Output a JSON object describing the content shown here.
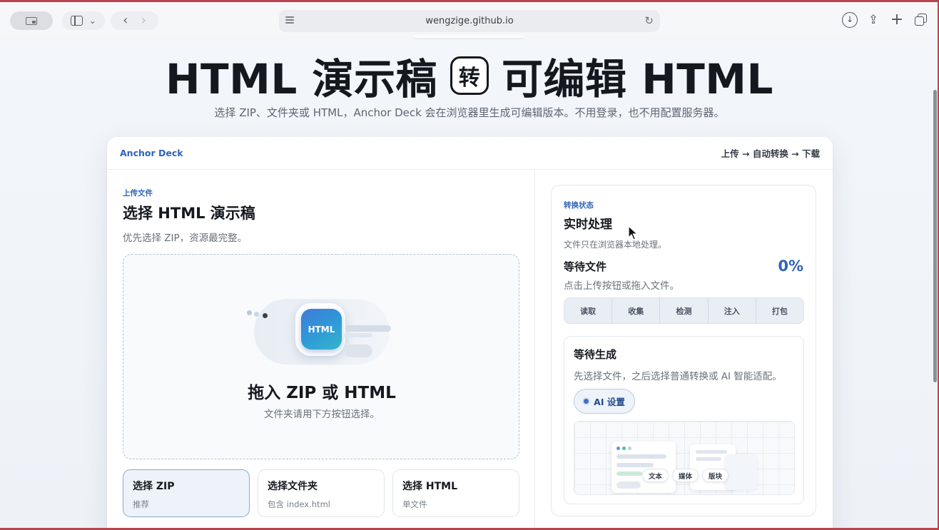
{
  "browser": {
    "url": "wengzige.github.io",
    "back_glyph": "‹",
    "forward_glyph": "›",
    "chevron_glyph": "⌄",
    "reload_glyph": "↻",
    "download_glyph": "↓",
    "share_glyph": "⇪",
    "plus_glyph": "+"
  },
  "hero": {
    "title_left": "HTML 演示稿",
    "badge": "转",
    "title_right": "可编辑 HTML",
    "subtitle": "选择 ZIP、文件夹或 HTML，Anchor Deck 会在浏览器里生成可编辑版本。不用登录，也不用配置服务器。"
  },
  "card": {
    "brand": "Anchor Deck",
    "flow": "上传 → 自动转换 → 下载"
  },
  "upload": {
    "eyebrow": "上传文件",
    "title": "选择 HTML 演示稿",
    "desc": "优先选择 ZIP，资源最完整。",
    "tile_label": "HTML",
    "drop_title": "拖入 ZIP 或 HTML",
    "drop_hint": "文件夹请用下方按钮选择。",
    "options": [
      {
        "title": "选择 ZIP",
        "sub": "推荐"
      },
      {
        "title": "选择文件夹",
        "sub": "包含 index.html"
      },
      {
        "title": "选择 HTML",
        "sub": "单文件"
      }
    ]
  },
  "status": {
    "eyebrow": "转换状态",
    "title": "实时处理",
    "note": "文件只在浏览器本地处理。",
    "waiting": "等待文件",
    "percent": "0%",
    "hint": "点击上传按钮或拖入文件。",
    "steps": [
      "读取",
      "收集",
      "检测",
      "注入",
      "打包"
    ],
    "gen_title": "等待生成",
    "gen_desc": "先选择文件，之后选择普通转换或 AI 智能适配。",
    "ai_button": "AI 设置",
    "chips": [
      "文本",
      "媒体",
      "版块"
    ]
  },
  "colors": {
    "accent": "#2f64b8",
    "frame": "#b8454e",
    "dot_blue": "#6b8fd6",
    "dot_green": "#4fbf95",
    "dot_gray": "#c5ccd6"
  }
}
